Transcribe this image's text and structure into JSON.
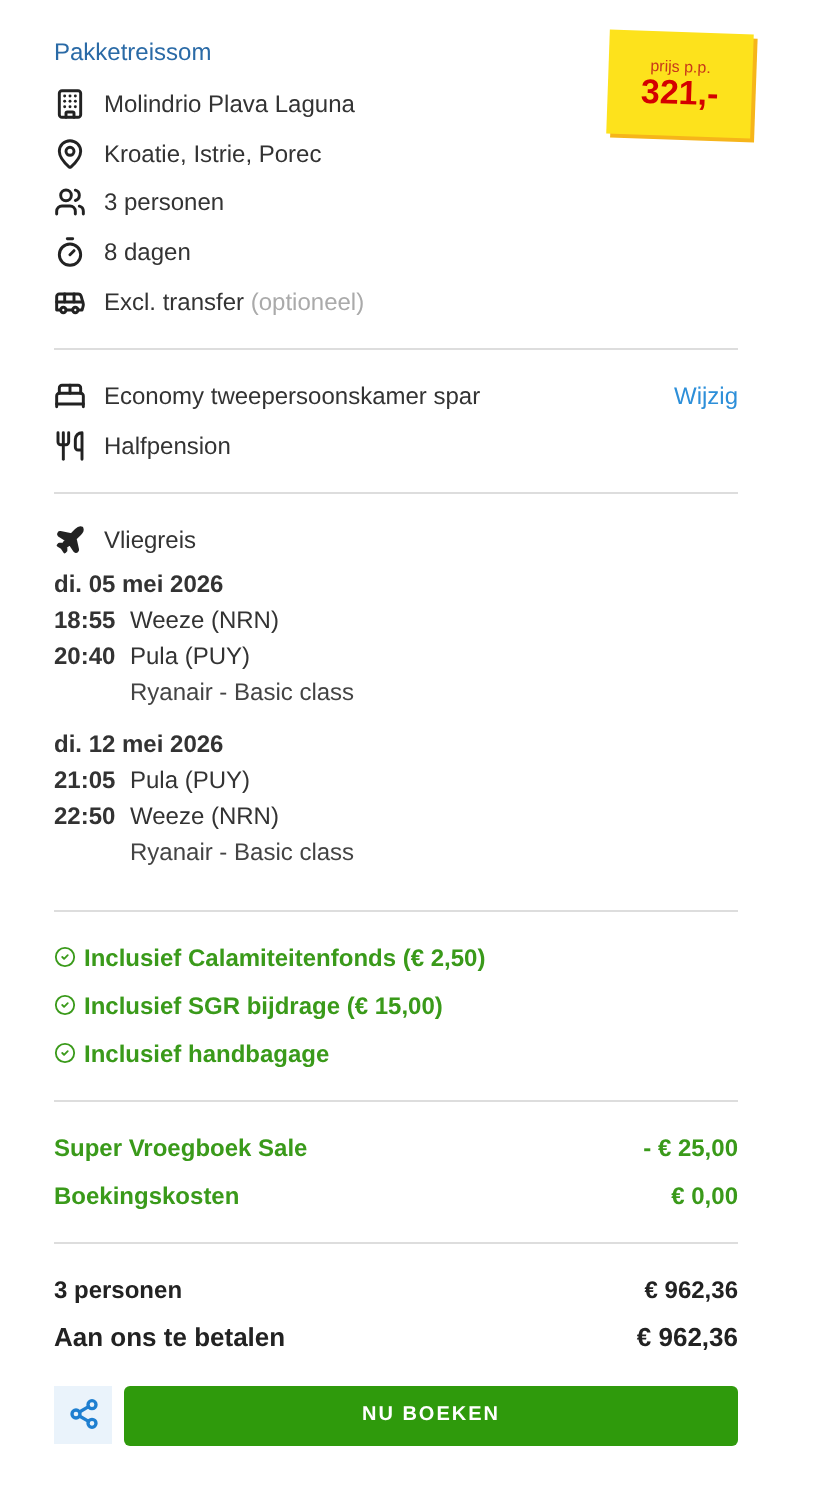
{
  "title": "Pakketreissom",
  "price": {
    "label": "prijs p.p.",
    "amount": "321,-"
  },
  "details": [
    {
      "text": "Molindrio Plava Laguna"
    },
    {
      "text": "Kroatie, Istrie, Porec"
    },
    {
      "text": "3 personen"
    },
    {
      "text": "8 dagen"
    },
    {
      "text": "Excl. transfer",
      "note": "(optioneel)"
    }
  ],
  "room": [
    {
      "text": "Economy tweepersoonskamer spar",
      "action": "Wijzig"
    },
    {
      "text": "Halfpension"
    }
  ],
  "flight": {
    "label": "Vliegreis",
    "legs": [
      {
        "date": "di. 05 mei 2026",
        "stops": [
          {
            "time": "18:55",
            "place": "Weeze (NRN)"
          },
          {
            "time": "20:40",
            "place": "Pula (PUY)"
          }
        ],
        "carrier": "Ryanair - Basic class"
      },
      {
        "date": "di. 12 mei 2026",
        "stops": [
          {
            "time": "21:05",
            "place": "Pula (PUY)"
          },
          {
            "time": "22:50",
            "place": "Weeze (NRN)"
          }
        ],
        "carrier": "Ryanair - Basic class"
      }
    ]
  },
  "inclusions": [
    "Inclusief Calamiteitenfonds (€ 2,50)",
    "Inclusief SGR bijdrage (€ 15,00)",
    "Inclusief handbagage"
  ],
  "discounts": [
    {
      "label": "Super Vroegboek Sale",
      "amount": "- € 25,00"
    },
    {
      "label": "Boekingskosten",
      "amount": "€ 0,00"
    }
  ],
  "totals": [
    {
      "label": "3 personen",
      "amount": "€ 962,36",
      "kind": "sub"
    },
    {
      "label": "Aan ons te betalen",
      "amount": "€ 962,36",
      "kind": "grand"
    }
  ],
  "book_button": "NU BOEKEN"
}
